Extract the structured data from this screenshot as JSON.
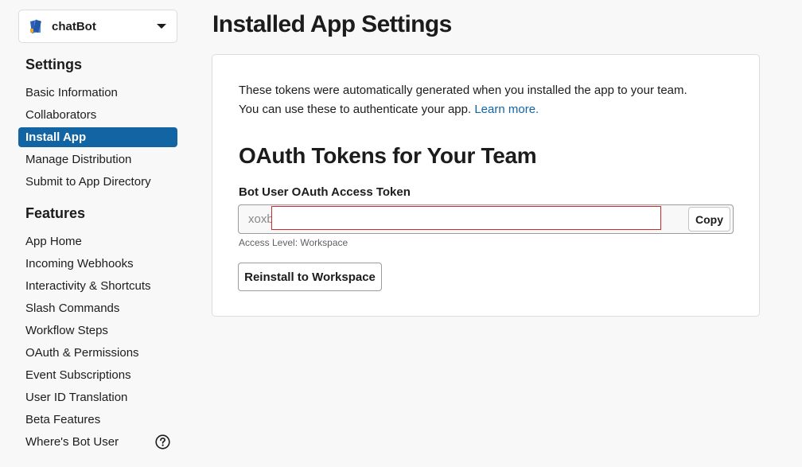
{
  "app_picker": {
    "name": "chatBot",
    "icon": "book-stack-icon"
  },
  "sidebar": {
    "settings_title": "Settings",
    "settings_items": [
      {
        "label": "Basic Information"
      },
      {
        "label": "Collaborators"
      },
      {
        "label": "Install App",
        "active": true
      },
      {
        "label": "Manage Distribution"
      },
      {
        "label": "Submit to App Directory"
      }
    ],
    "features_title": "Features",
    "features_items": [
      {
        "label": "App Home"
      },
      {
        "label": "Incoming Webhooks"
      },
      {
        "label": "Interactivity & Shortcuts"
      },
      {
        "label": "Slash Commands"
      },
      {
        "label": "Workflow Steps"
      },
      {
        "label": "OAuth & Permissions"
      },
      {
        "label": "Event Subscriptions"
      },
      {
        "label": "User ID Translation"
      },
      {
        "label": "Beta Features"
      },
      {
        "label": "Where's Bot User",
        "icon": "help-circle-icon"
      }
    ]
  },
  "main": {
    "title": "Installed App Settings",
    "intro_line1": "These tokens were automatically generated when you installed the app to your team.",
    "intro_line2": "You can use these to authenticate your app.",
    "learn_more": "Learn more.",
    "oauth_heading": "OAuth Tokens for Your Team",
    "token_label": "Bot User OAuth Access Token",
    "token_value": "xoxb",
    "copy_label": "Copy",
    "access_level": "Access Level: Workspace",
    "reinstall_label": "Reinstall to Workspace"
  },
  "colors": {
    "accent": "#1264a3",
    "redaction_border": "#cc2b2b",
    "background": "#f8f8f8"
  }
}
